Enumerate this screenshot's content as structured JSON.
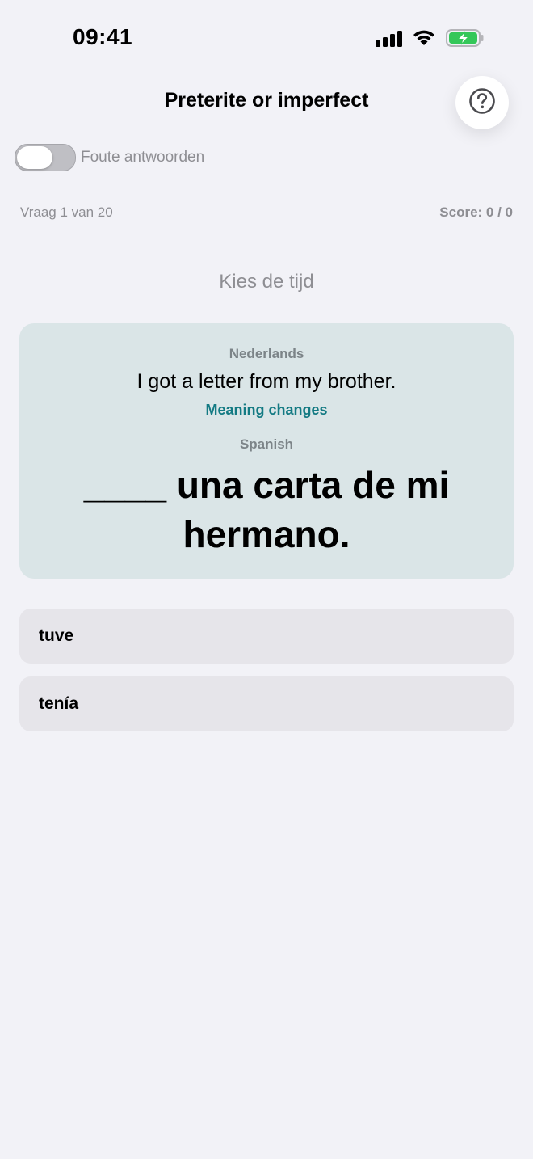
{
  "status": {
    "time": "09:41",
    "icons": [
      "signal-icon",
      "wifi-icon",
      "battery-charging-icon"
    ],
    "battery_color": "#34c759"
  },
  "nav": {
    "title": "Preterite or imperfect",
    "help_icon": "question-circle-icon"
  },
  "toggle": {
    "label": "Foute antwoorden",
    "on": false
  },
  "quiz": {
    "progress": "Vraag 1 van 20",
    "score": "Score: 0 / 0",
    "instruction": "Kies de tijd"
  },
  "card": {
    "source_language": "Nederlands",
    "source_sentence": "I got a letter from my brother.",
    "hint": "Meaning changes",
    "target_language": "Spanish",
    "target_sentence": "____ una carta de mi hermano.",
    "background": "#dae5e7",
    "hint_color": "#137a83"
  },
  "options": [
    {
      "label": "tuve"
    },
    {
      "label": "tenía"
    }
  ]
}
